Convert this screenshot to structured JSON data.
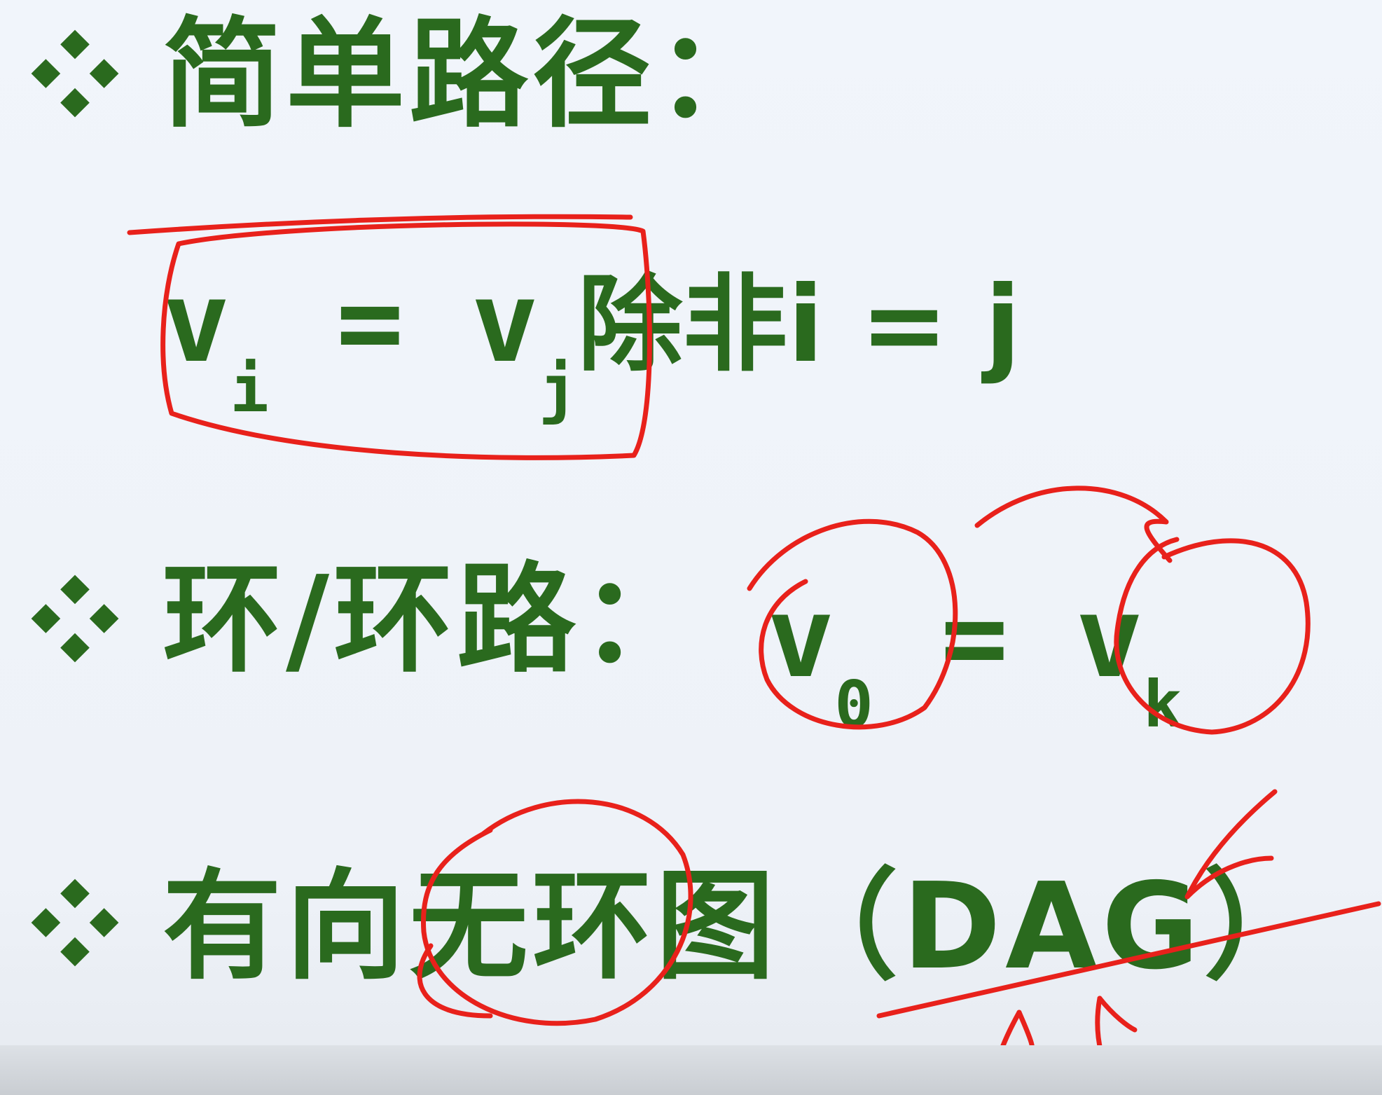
{
  "simple_path": {
    "heading": "简单路径：",
    "formula": {
      "v1": "v",
      "sub1": "i",
      "eq": " = ",
      "v2": "v",
      "sub2": "j",
      "cond": "除非i = j"
    }
  },
  "cycle": {
    "heading": "环/环路：",
    "v1": "v",
    "sub1": "0",
    "eq": " = ",
    "v2": "v",
    "sub2": "k"
  },
  "dag": {
    "heading": "有向无环图（DAG）"
  },
  "colors": {
    "text": "#2a6a1e",
    "annotation": "#e8211b",
    "background": "#eff3f9"
  },
  "icons": {
    "bullet": "four-diamond-bullet-icon"
  }
}
